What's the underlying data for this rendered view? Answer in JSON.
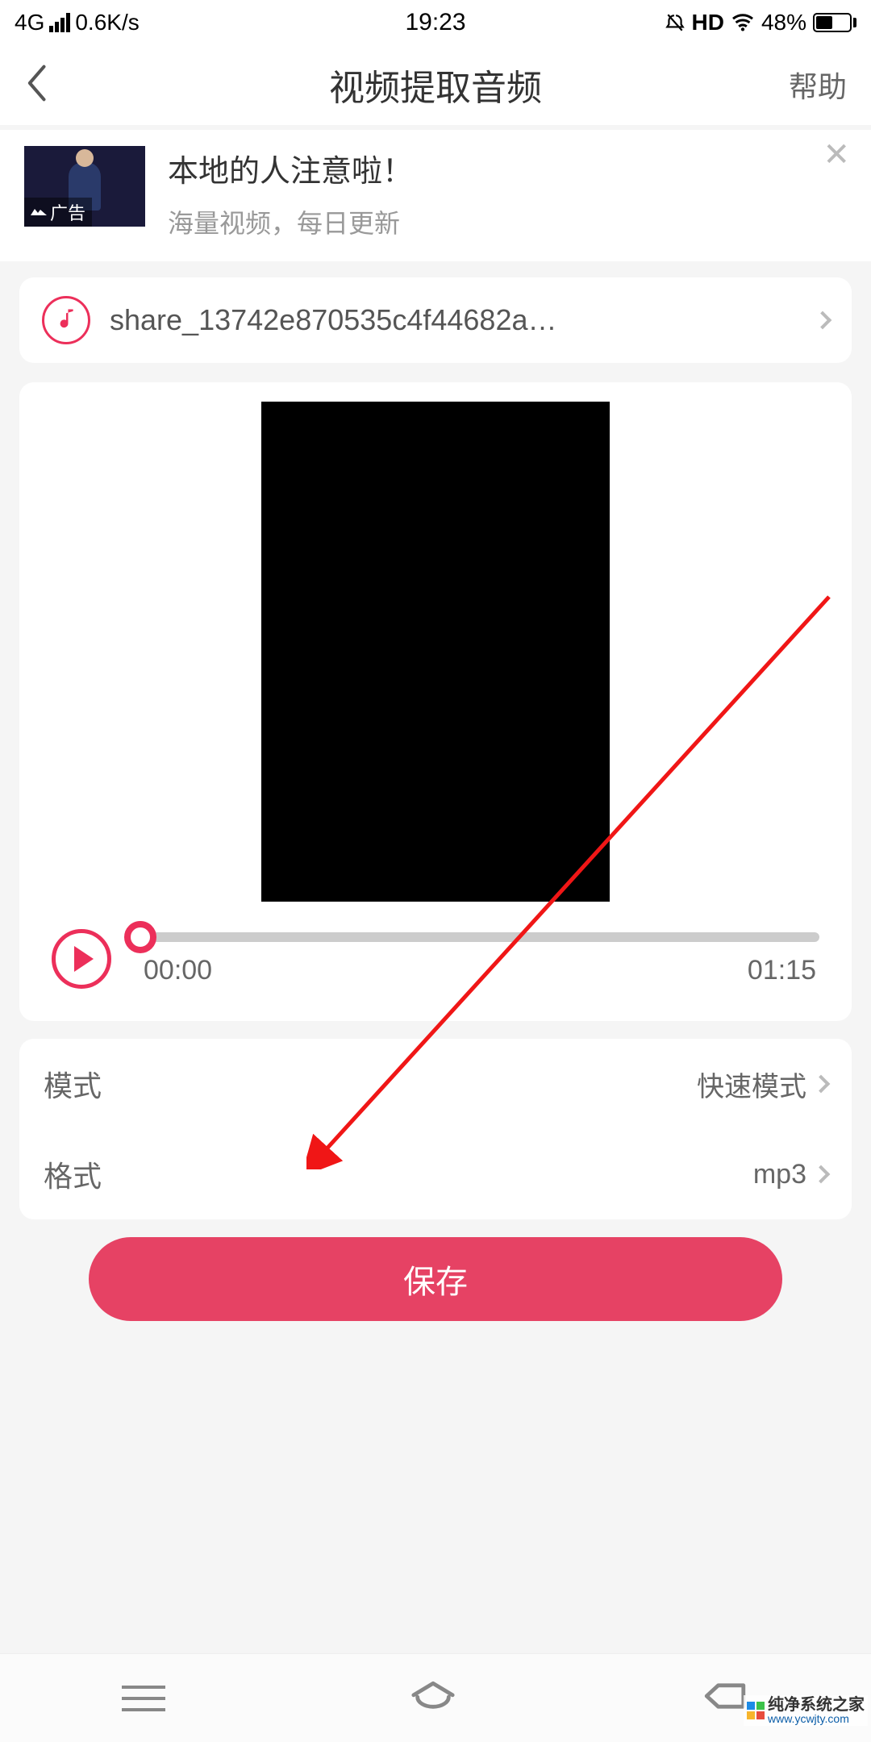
{
  "status_bar": {
    "network_type": "4G",
    "speed": "0.6K/s",
    "time": "19:23",
    "hd": "HD",
    "battery_pct": "48%"
  },
  "header": {
    "title": "视频提取音频",
    "help_label": "帮助"
  },
  "ad": {
    "title": "本地的人注意啦！",
    "subtitle": "海量视频，每日更新",
    "badge": "广告"
  },
  "file": {
    "name": "share_13742e870535c4f44682a…"
  },
  "player": {
    "current_time": "00:00",
    "duration": "01:15"
  },
  "settings": {
    "mode_label": "模式",
    "mode_value": "快速模式",
    "format_label": "格式",
    "format_value": "mp3"
  },
  "actions": {
    "save_label": "保存"
  },
  "watermark": {
    "cn": "纯净系统之家",
    "url": "www.ycwjty.com"
  }
}
